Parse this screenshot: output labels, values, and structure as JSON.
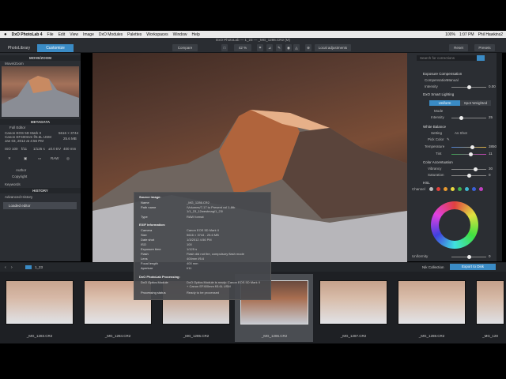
{
  "menubar": {
    "apple": "",
    "app": "DxO PhotoLab 4",
    "items": [
      "File",
      "Edit",
      "View",
      "Image",
      "DxO Modules",
      "Palettes",
      "Workspaces",
      "Window",
      "Help"
    ],
    "status": {
      "zoom": "100%",
      "time": "1:07 PM",
      "user": "Phil Hawkins2"
    }
  },
  "window": {
    "title": "DxO PhotoLab — 1_23 — _MG_1286.CR2 (M)"
  },
  "tabs": {
    "library": "PhotoLibrary",
    "customize": "Customize"
  },
  "toolbar": {
    "compare": "Compare",
    "zoom": "42 %",
    "local_adjustments": "Local adjustments",
    "reset": "Reset",
    "presets": "Presets"
  },
  "left": {
    "move_zoom_title": "MOVE/ZOOM",
    "move_zoom_item": "Move/Zoom",
    "metadata_title": "METADATA",
    "full_editor": "Full Editor",
    "camera": "Canon EOS 5D Mark II",
    "lens": "Canon EF400mm f/5.6L USM",
    "date": "Jan 03, 2012 at 4:56 PM",
    "res": "5616 × 3744",
    "size": "25.6 MB",
    "exif": [
      "ISO 100",
      "f/11",
      "1/125 s",
      "±0.0 EV",
      "400 mm"
    ],
    "raw": "RAW",
    "author": "Author",
    "copyright": "Copyright",
    "keywords": "Keywords",
    "history_title": "HISTORY",
    "adv_history": "Advanced History",
    "history_item": "Loaded editor"
  },
  "right": {
    "search_placeholder": "Search for corrections",
    "sections": {
      "exposure": "Exposure Compensation",
      "smart_lighting": "DxO Smart Lighting",
      "white_balance": "White Balance",
      "color_accent": "Color Accentuation",
      "hsl": "HSL"
    },
    "compensation": "Compensation",
    "compensation_value": "Manual",
    "intensity_label": "Intensity",
    "intensity_value": "0.00",
    "sl_uniform": "Uniform",
    "sl_spot": "Spot Weighted",
    "sl_mode": "Mode",
    "sl_intensity": "Intensity",
    "sl_intensity_value": "25",
    "wb_setting": "Setting",
    "wb_setting_value": "As Shot",
    "wb_picker": "Pick Color",
    "wb_temp": "Temperature",
    "wb_temp_value": "3850",
    "wb_tint": "Tint",
    "wb_tint_value": "11",
    "ca_vibrancy": "Vibrancy",
    "ca_vibrancy_value": "30",
    "ca_saturation": "Saturation",
    "ca_saturation_value": "0",
    "hsl_channel": "Channel",
    "hsl_uniformity": "Uniformity",
    "hsl_uniformity_value": "0"
  },
  "filmstrip": {
    "folder": "1_23",
    "nik": "Nik Collection",
    "export": "Export to Disk",
    "thumbs": [
      "_MG_1283.CR2",
      "_MG_1284.CR2",
      "_MG_1285.CR2",
      "_MG_1286.CR2",
      "_MG_1287.CR2",
      "_MG_1288.CR2",
      "_MG_128"
    ]
  },
  "tooltip": {
    "source_title": "Source image:",
    "name_k": "Name",
    "name_v": "_MG_1286.CR2",
    "path_k": "Path name",
    "path_v": "/Volumes/7-17 to Present vol 1-8tb",
    "path_v2": "1/1_23_12westmag/1_23/",
    "type_k": "Type",
    "type_v": "RAW format",
    "exif_title": "EXIF information:",
    "camera_k": "Camera",
    "camera_v": "Canon EOS 5D Mark II",
    "size_k": "Size",
    "size_v": "5616 × 3744 - 25.6 MB",
    "date_k": "Date shot",
    "date_v": "1/3/2012 4:56 PM",
    "iso_k": "ISO",
    "iso_v": "100",
    "exp_k": "Exposure time",
    "exp_v": "1/125 s",
    "flash_k": "Flash",
    "flash_v": "Flash did not fire, compulsory flash mode",
    "lens_k": "Lens",
    "lens_v": "400mm f/5.6",
    "focal_k": "Focal length",
    "focal_v": "400 mm",
    "ap_k": "Aperture",
    "ap_v": "f/11",
    "proc_title": "DxO PhotoLab Processing:",
    "optics_k": "DxO Optics Module",
    "optics_v": "DxO Optics Module is ready: Canon EOS 5D Mark II",
    "optics_v2": "+ Canon EF400mm f/5.6L USM",
    "status_k": "Processing status",
    "status_v": "Ready to be processed"
  },
  "colors": {
    "accent": "#3a8bc5",
    "panel": "#2b2e33"
  }
}
